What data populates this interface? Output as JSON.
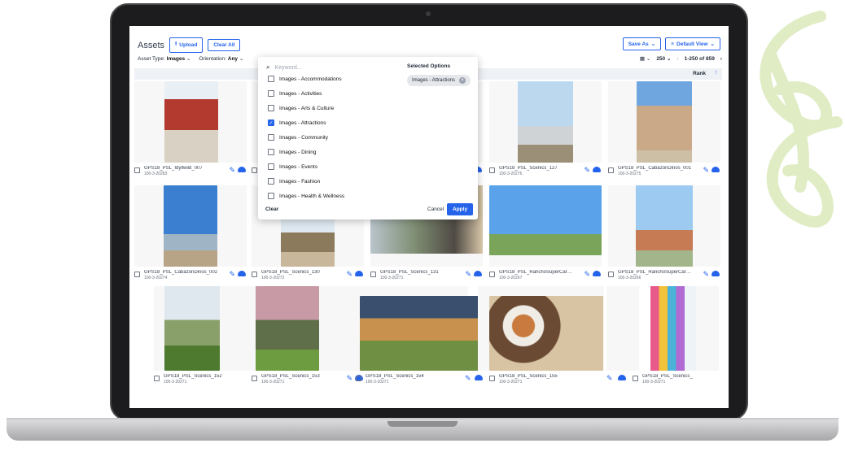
{
  "header": {
    "title": "Assets",
    "upload_label": "Upload",
    "clear_all_label": "Clear All",
    "save_as_label": "Save As",
    "view_label": "Default View"
  },
  "filters": {
    "asset_type_label": "Asset Type:",
    "asset_type_value": "Images",
    "orientation_label": "Orientation:",
    "orientation_value": "Any"
  },
  "pager": {
    "page_size": "250",
    "range": "1-250 of 859"
  },
  "sort": {
    "label": "Rank"
  },
  "dropdown": {
    "search_placeholder": "Keyword...",
    "options": [
      {
        "label": "Images - Accommodations",
        "checked": false
      },
      {
        "label": "Images - Activities",
        "checked": false
      },
      {
        "label": "Images - Arts & Culture",
        "checked": false
      },
      {
        "label": "Images - Attractions",
        "checked": true
      },
      {
        "label": "Images - Community",
        "checked": false
      },
      {
        "label": "Images - Dining",
        "checked": false
      },
      {
        "label": "Images - Events",
        "checked": false
      },
      {
        "label": "Images - Fashion",
        "checked": false
      },
      {
        "label": "Images - Health & Wellness",
        "checked": false
      }
    ],
    "selected_heading": "Selected Options",
    "selected_chip": "Images - Attractions",
    "clear_label": "Clear",
    "cancel_label": "Cancel",
    "apply_label": "Apply"
  },
  "assets": [
    {
      "name": "GPS18_PSL_Idyllwild_007",
      "id": "100-3-20283"
    },
    {
      "name": "",
      "id": ""
    },
    {
      "name": "",
      "id": ""
    },
    {
      "name": "GPS18_PSL_Scenics_127",
      "id": "100-3-20276"
    },
    {
      "name": "GPS18_PSL_CabazonDinos_001",
      "id": "100-3-20275"
    },
    {
      "name": "GPS18_PSL_CabazonDinos_002",
      "id": "100-3-20274"
    },
    {
      "name": "GPS18_PSL_Scenics_130",
      "id": "100-3-20272"
    },
    {
      "name": "GPS18_PSL_Scenics_131",
      "id": "100-3-20271"
    },
    {
      "name": "GPS18_PSL_RanchoSuperCarW...",
      "id": "100-3-20267"
    },
    {
      "name": "GPS18_PSL_RanchoSuperCarW...",
      "id": "100-3-20266"
    },
    {
      "name": "GPS18_PSL_Scenics_152",
      "id": "100-3-20271"
    },
    {
      "name": "GPS18_PSL_Scenics_153",
      "id": "100-3-20271"
    },
    {
      "name": "GPS18_PSL_Scenics_154",
      "id": "100-3-20271"
    },
    {
      "name": "GPS18_PSL_Scenics_155",
      "id": "100-3-20271"
    },
    {
      "name": "GPS18_PSL_Scenics_",
      "id": "100-3-20271"
    }
  ],
  "colors": {
    "accent": "#2563eb",
    "swirl": "#dfecc4"
  }
}
